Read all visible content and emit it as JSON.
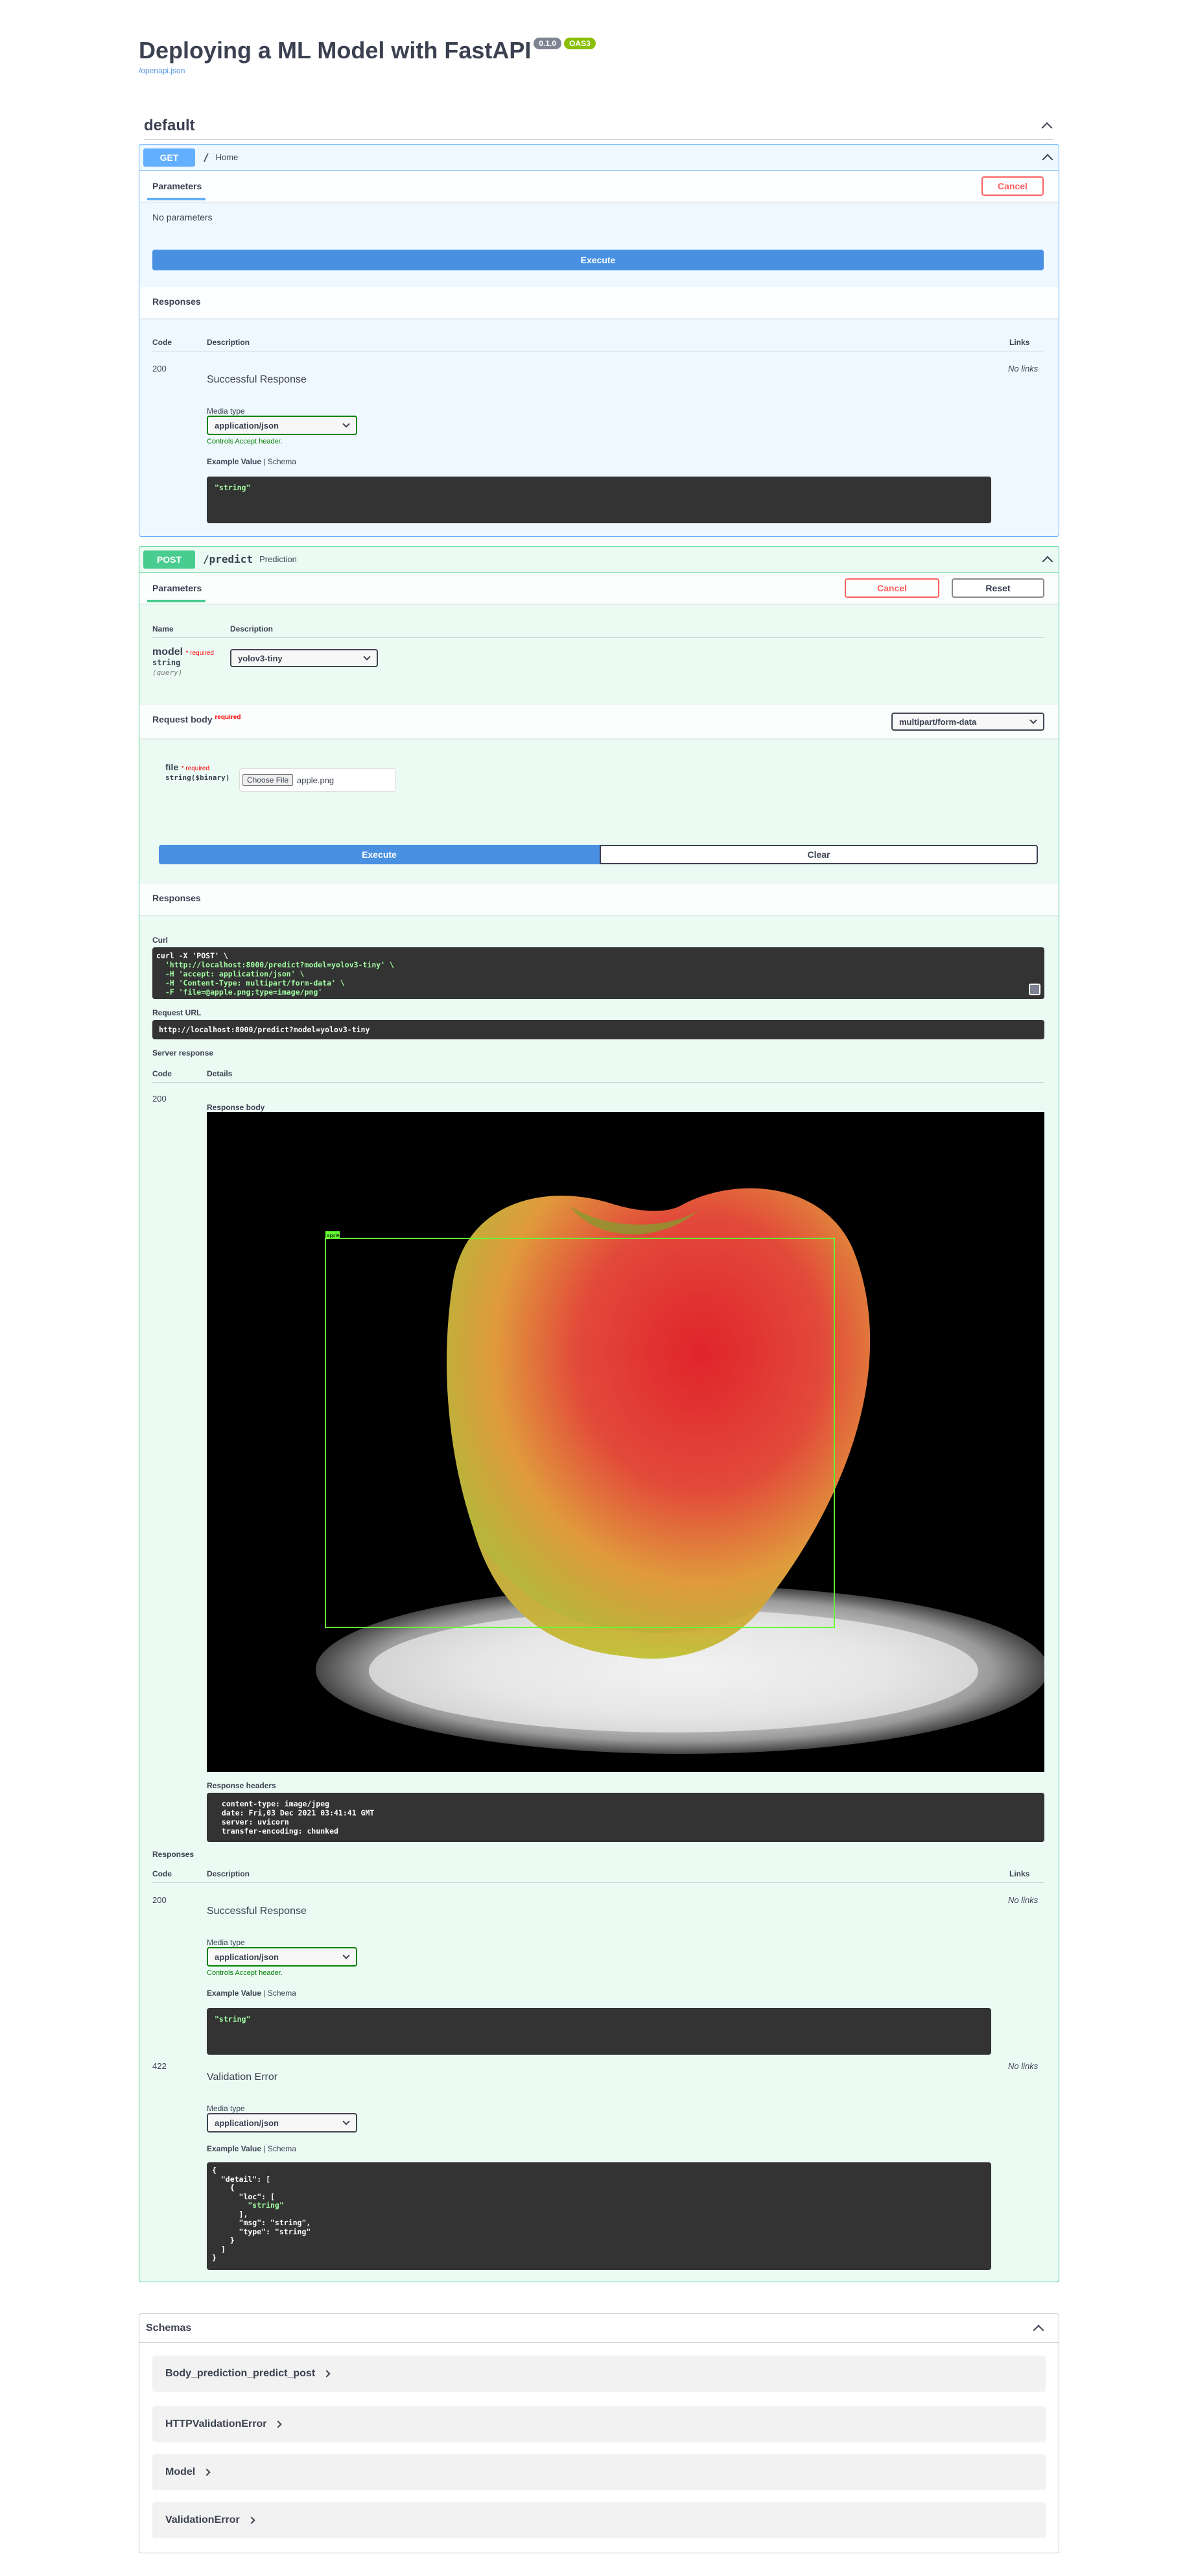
{
  "header": {
    "title": "Deploying a ML Model with FastAPI",
    "version": "0.1.0",
    "oas": "OAS3",
    "openapi_link": "/openapi.json"
  },
  "section": {
    "name": "default"
  },
  "get_op": {
    "method": "GET",
    "path": "/",
    "summary": "Home",
    "tab": "Parameters",
    "cancel": "Cancel",
    "no_params": "No parameters",
    "execute": "Execute",
    "responses_title": "Responses",
    "col_code": "Code",
    "col_description": "Description",
    "col_links": "Links",
    "resp_code": "200",
    "resp_desc": "Successful Response",
    "no_links": "No links",
    "media_type_label": "Media type",
    "media_type": "application/json",
    "controls_note": "Controls Accept header.",
    "example_value": "Example Value",
    "schema": "Schema",
    "example": "\"string\""
  },
  "post_op": {
    "method": "POST",
    "path": "/predict",
    "summary": "Prediction",
    "tab": "Parameters",
    "cancel": "Cancel",
    "reset": "Reset",
    "col_name": "Name",
    "col_description": "Description",
    "param_name": "model",
    "required": "* required",
    "param_type": "string",
    "param_in": "(query)",
    "param_value": "yolov3-tiny",
    "request_body": "Request body",
    "request_body_required": "required",
    "content_type": "multipart/form-data",
    "file_label": "file",
    "file_type": "string($binary)",
    "choose_file": "Choose File",
    "file_name": "apple.png",
    "execute": "Execute",
    "clear": "Clear",
    "responses_title": "Responses",
    "curl_label": "Curl",
    "curl_lines": [
      "curl -X 'POST' \\",
      "  'http://localhost:8000/predict?model=yolov3-tiny' \\",
      "  -H 'accept: application/json' \\",
      "  -H 'Content-Type: multipart/form-data' \\",
      "  -F 'file=@apple.png;type=image/png'"
    ],
    "request_url_label": "Request URL",
    "request_url": "http://localhost:8000/predict?model=yolov3-tiny",
    "server_response": "Server response",
    "col_code": "Code",
    "col_details": "Details",
    "resp_code": "200",
    "response_body": "Response body",
    "detection_label": "apple",
    "response_headers_label": "Response headers",
    "response_headers": [
      " content-type: image/jpeg ",
      " date: Fri,03 Dec 2021 03:41:41 GMT ",
      " server: uvicorn ",
      " transfer-encoding: chunked "
    ],
    "responses2_title": "Responses",
    "col_description2": "Description",
    "col_links": "Links",
    "r200_code": "200",
    "r200_desc": "Successful Response",
    "no_links": "No links",
    "media_type_label": "Media type",
    "media_type": "application/json",
    "controls_note": "Controls Accept header.",
    "example_value": "Example Value",
    "schema": "Schema",
    "r200_example": "\"string\"",
    "r422_code": "422",
    "r422_desc": "Validation Error",
    "r422_example": [
      "{",
      "  \"detail\": [",
      "    {",
      "      \"loc\": [",
      "        \"string\"",
      "      ],",
      "      \"msg\": \"string\",",
      "      \"type\": \"string\"",
      "    }",
      "  ]",
      "}"
    ]
  },
  "schemas": {
    "title": "Schemas",
    "items": [
      "Body_prediction_predict_post",
      "HTTPValidationError",
      "Model",
      "ValidationError"
    ]
  },
  "colors": {
    "get": "#61affe",
    "post": "#49cc90",
    "execute": "#4990e2",
    "cancel": "#ff6060"
  }
}
